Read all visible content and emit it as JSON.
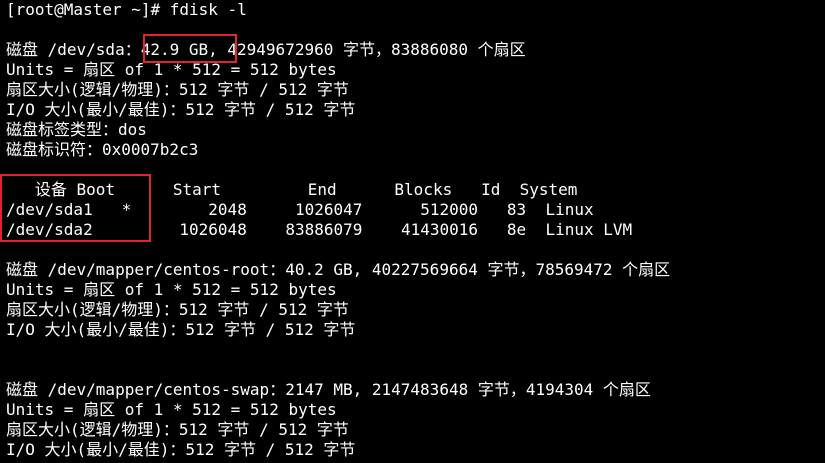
{
  "terminal": {
    "lines": [
      "[root@Master ~]# fdisk -l",
      "",
      "磁盘 /dev/sda：42.9 GB, 42949672960 字节，83886080 个扇区",
      "Units = 扇区 of 1 * 512 = 512 bytes",
      "扇区大小(逻辑/物理)：512 字节 / 512 字节",
      "I/O 大小(最小/最佳)：512 字节 / 512 字节",
      "磁盘标签类型：dos",
      "磁盘标识符：0x0007b2c3",
      "",
      "   设备 Boot      Start         End      Blocks   Id  System",
      "/dev/sda1   *        2048     1026047      512000   83  Linux",
      "/dev/sda2         1026048    83886079    41430016   8e  Linux LVM",
      "",
      "磁盘 /dev/mapper/centos-root：40.2 GB, 40227569664 字节，78569472 个扇区",
      "Units = 扇区 of 1 * 512 = 512 bytes",
      "扇区大小(逻辑/物理)：512 字节 / 512 字节",
      "I/O 大小(最小/最佳)：512 字节 / 512 字节",
      "",
      "",
      "磁盘 /dev/mapper/centos-swap：2147 MB, 2147483648 字节，4194304 个扇区",
      "Units = 扇区 of 1 * 512 = 512 bytes",
      "扇区大小(逻辑/物理)：512 字节 / 512 字节",
      "I/O 大小(最小/最佳)：512 字节 / 512 字节"
    ]
  },
  "colors": {
    "background": "#000000",
    "text": "#ffffff",
    "highlight": "#e1252d"
  }
}
